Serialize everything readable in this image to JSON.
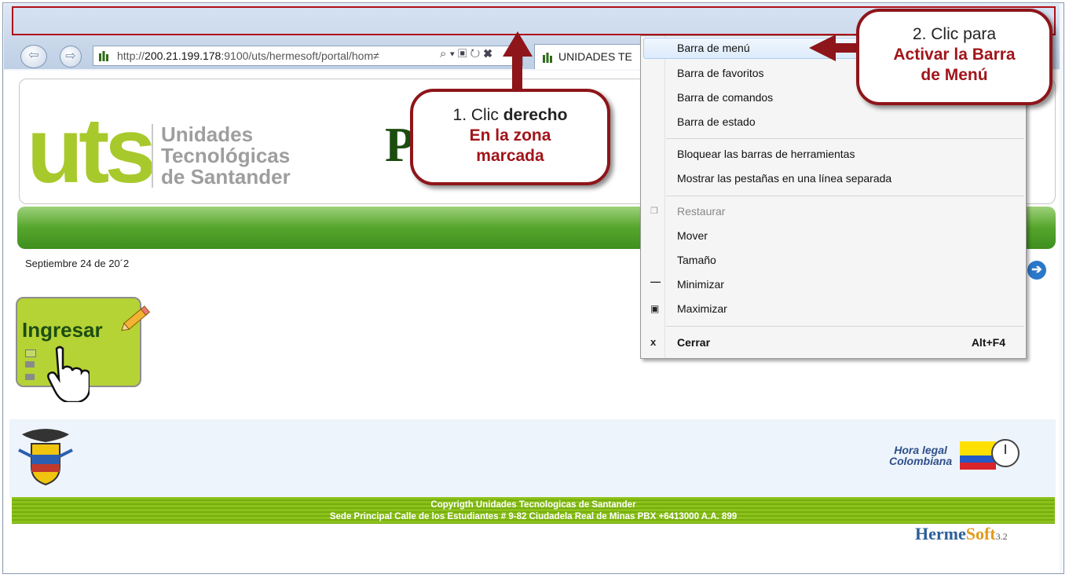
{
  "browser": {
    "url_prefix": "http://",
    "url_host": "200.21.199.178",
    "url_rest": ":9100/uts/hermesoft/portal/hom≠",
    "tab_title": "UNIDADES TE",
    "addr_icons": "⌕ ▾ ▣ ↻ ✖"
  },
  "site": {
    "logo_text": "uts",
    "name_line1": "Unidades",
    "name_line2": "Tecnológicas",
    "name_line3": "de Santander",
    "portal_title": "P            ad",
    "date": "Septiembre 24 de 20´2",
    "ingresar": "Ingresar",
    "copyright_line1": "Copyrigth Unidades Tecnologicas de Santander",
    "copyright_line2": "Sede Principal Calle de los Estudiantes # 9-82 Ciudadela Real de Minas PBX +6413000 A.A. 899",
    "hora_line1": "Hora legal",
    "hora_line2": "Colombiana",
    "hermesoft_a": "Herme",
    "hermesoft_b": "Soft",
    "hermesoft_version": "3.2"
  },
  "context_menu": {
    "items": [
      {
        "label": "Barra de menú"
      },
      {
        "label": "Barra de favoritos"
      },
      {
        "label": "Barra de comandos"
      },
      {
        "label": "Barra de estado"
      },
      {
        "label": "Bloquear las barras de herramientas"
      },
      {
        "label": "Mostrar las pestañas en una línea separada"
      },
      {
        "label": "Restaurar"
      },
      {
        "label": "Mover"
      },
      {
        "label": "Tamaño"
      },
      {
        "label": "Minimizar"
      },
      {
        "label": "Maximizar"
      },
      {
        "label": "Cerrar"
      }
    ],
    "close_shortcut": "Alt+F4"
  },
  "callouts": {
    "one_line1_plain": "1. Clic ",
    "one_line1_bold": "derecho",
    "one_line2": "En la zona",
    "one_line3": "marcada",
    "two_line1": "2. Clic  para",
    "two_line2": "Activar la Barra",
    "two_line3": "de Menú"
  },
  "colors": {
    "accent_red": "#8e1519",
    "uts_green": "#a8c92c",
    "bar_green": "#55a52c"
  }
}
